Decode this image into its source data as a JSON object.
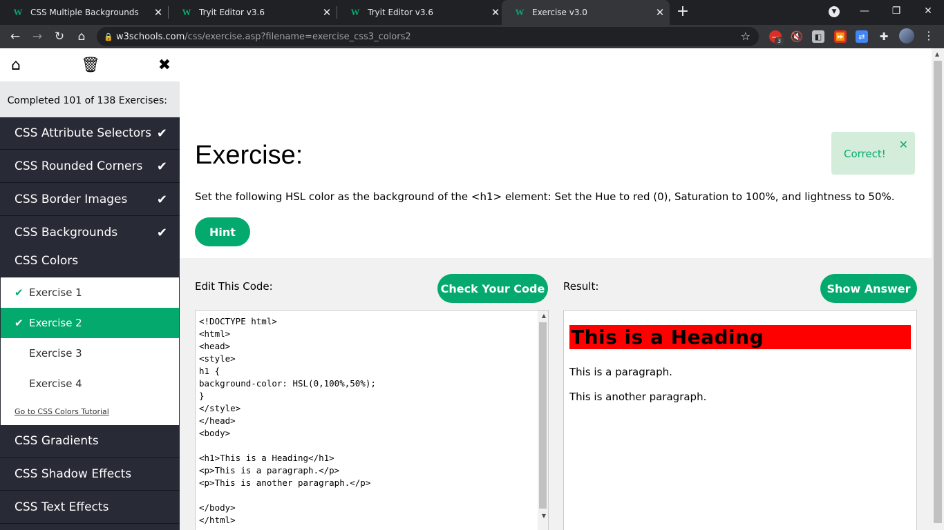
{
  "browser": {
    "tabs": [
      {
        "title": "CSS Multiple Backgrounds",
        "active": false
      },
      {
        "title": "Tryit Editor v3.6",
        "active": false
      },
      {
        "title": "Tryit Editor v3.6",
        "active": false
      },
      {
        "title": "Exercise v3.0",
        "active": true
      }
    ],
    "url_host": "w3schools.com",
    "url_path": "/css/exercise.asp?filename=exercise_css3_colors2",
    "extension_badge": "3"
  },
  "sidebar": {
    "progress": "Completed 101 of 138 Exercises:",
    "items_top": [
      {
        "label": "CSS Attribute Selectors",
        "done": true
      },
      {
        "label": "CSS Rounded Corners",
        "done": true
      },
      {
        "label": "CSS Border Images",
        "done": true
      },
      {
        "label": "CSS Backgrounds",
        "done": true
      },
      {
        "label": "CSS Colors",
        "done": false
      }
    ],
    "sub_items": [
      {
        "label": "Exercise 1",
        "done": true,
        "active": false
      },
      {
        "label": "Exercise 2",
        "done": true,
        "active": true
      },
      {
        "label": "Exercise 3",
        "done": false,
        "active": false
      },
      {
        "label": "Exercise 4",
        "done": false,
        "active": false
      }
    ],
    "tutorial_link": "Go to CSS Colors Tutorial",
    "items_bottom": [
      {
        "label": "CSS Gradients"
      },
      {
        "label": "CSS Shadow Effects"
      },
      {
        "label": "CSS Text Effects"
      }
    ]
  },
  "main": {
    "title": "Exercise:",
    "feedback": "Correct!",
    "instructions": "Set the following HSL color as the background of the <h1> element: Set the Hue to red (0), Saturation to 100%, and lightness to 50%.",
    "hint_label": "Hint",
    "edit_label": "Edit This Code:",
    "check_label": "Check Your Code",
    "result_label": "Result:",
    "show_answer_label": "Show Answer",
    "code": "<!DOCTYPE html>\n<html>\n<head>\n<style>\nh1 {\nbackground-color: HSL(0,100%,50%);\n}\n</style>\n</head>\n<body>\n\n<h1>This is a Heading</h1>\n<p>This is a paragraph.</p>\n<p>This is another paragraph.</p>\n\n</body>\n</html>",
    "result": {
      "heading": "This is a Heading",
      "heading_bg": "#ff0000",
      "paragraphs": [
        "This is a paragraph.",
        "This is another paragraph."
      ]
    }
  },
  "colors": {
    "accent": "#04aa6d",
    "sidebar": "#282a35",
    "chrome": "#202124"
  }
}
